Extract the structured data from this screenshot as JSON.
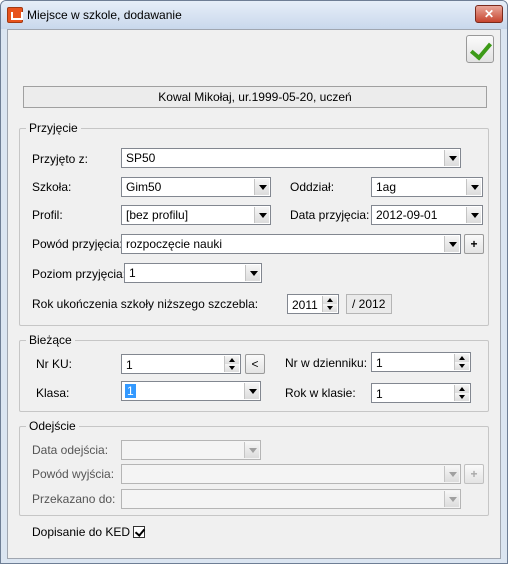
{
  "window": {
    "title": "Miejsce w szkole, dodawanie",
    "close_symbol": "✕"
  },
  "toolbar": {
    "ok_icon": "check-icon"
  },
  "person": {
    "text": "Kowal Mikołaj, ur.1999-05-20, uczeń"
  },
  "przyjecie": {
    "title": "Przyjęcie",
    "przyjeto_z": {
      "label": "Przyjęto z:",
      "value": "SP50"
    },
    "szkola": {
      "label": "Szkoła:",
      "value": "Gim50"
    },
    "oddzial": {
      "label": "Oddział:",
      "value": "1ag"
    },
    "profil": {
      "label": "Profil:",
      "value": "[bez profilu]"
    },
    "data_przyjecia": {
      "label": "Data przyjęcia:",
      "value": "2012-09-01"
    },
    "powod": {
      "label": "Powód przyjęcia:",
      "value": "rozpoczęcie nauki",
      "add": "+"
    },
    "poziom": {
      "label": "Poziom przyjęcia:",
      "value": "1"
    },
    "rok_ukonczenia": {
      "label": "Rok ukończenia szkoły niższego szczebla:",
      "value": "2011",
      "suffix": "/ 2012"
    }
  },
  "biezace": {
    "title": "Bieżące",
    "nr_ku": {
      "label": "Nr KU:",
      "value": "1",
      "btn": "<"
    },
    "nr_dziennik": {
      "label": "Nr w dzienniku:",
      "value": "1"
    },
    "klasa": {
      "label": "Klasa:",
      "value": "1"
    },
    "rok_w_klasie": {
      "label": "Rok w klasie:",
      "value": "1"
    }
  },
  "odejscie": {
    "title": "Odejście",
    "data": {
      "label": "Data odejścia:",
      "value": ""
    },
    "powod": {
      "label": "Powód wyjścia:",
      "value": "",
      "add": "+"
    },
    "przekazano": {
      "label": "Przekazano do:",
      "value": ""
    }
  },
  "ked": {
    "label": "Dopisanie do KED",
    "checked": true
  }
}
